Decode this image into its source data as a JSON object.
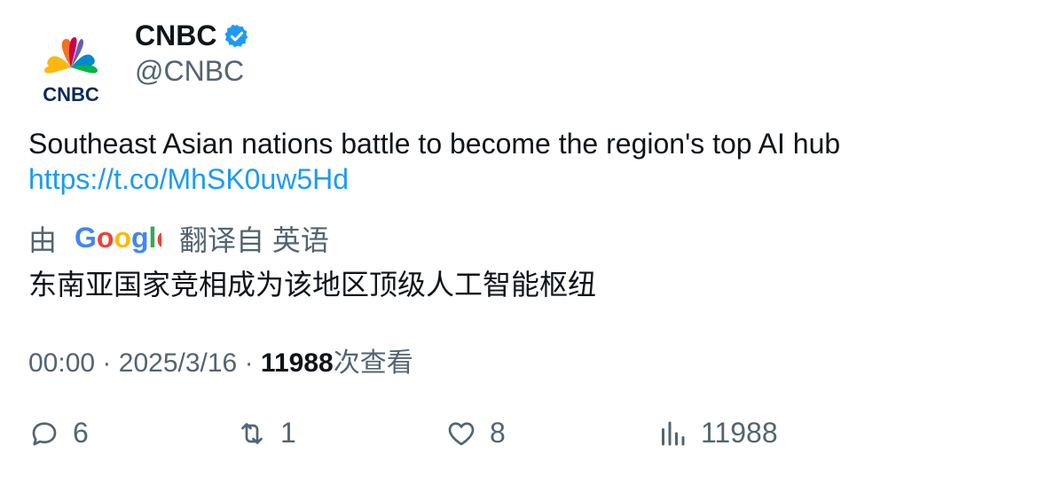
{
  "author": {
    "name": "CNBC",
    "handle": "@CNBC",
    "logo_text": "CNBC",
    "verified": true,
    "verified_color": "#1d9bf0"
  },
  "tweet": {
    "text": "Southeast Asian nations battle to become the region's top AI hub",
    "link": "https://t.co/MhSK0uw5Hd"
  },
  "translation": {
    "prefix": "由",
    "provider": "Google",
    "suffix": "翻译自 英语",
    "text": "东南亚国家竞相成为该地区顶级人工智能枢纽"
  },
  "meta": {
    "time": "00:00",
    "separator": "·",
    "date": "2025/3/16",
    "views": "11988",
    "views_label": "次查看"
  },
  "actions": {
    "replies": "6",
    "retweets": "1",
    "likes": "8",
    "views": "11988"
  },
  "colors": {
    "text": "#0f1419",
    "secondary": "#536471",
    "link": "#1d9bf0"
  }
}
